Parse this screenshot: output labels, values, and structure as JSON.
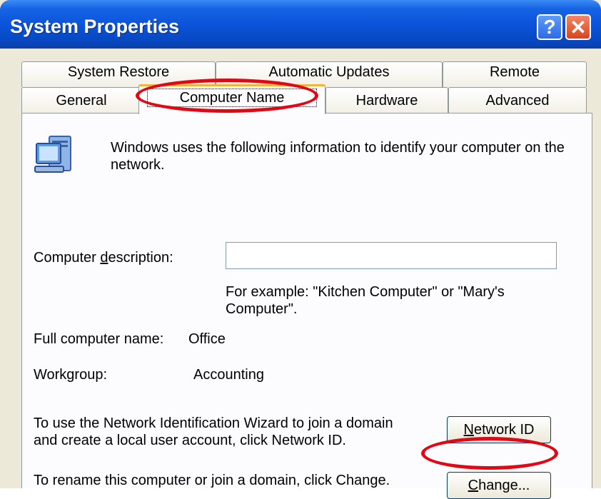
{
  "window": {
    "title": "System Properties"
  },
  "titlebar_buttons": {
    "help": "?",
    "close": "✕"
  },
  "tabs_row1": [
    "System Restore",
    "Automatic Updates",
    "Remote"
  ],
  "tabs_row2": [
    "General",
    "Computer Name",
    "Hardware",
    "Advanced"
  ],
  "active_tab": "Computer Name",
  "icon": "computer-network-icon",
  "intro": "Windows uses the following information to identify your computer on the network.",
  "description": {
    "label_pre": "Computer ",
    "label_accel": "d",
    "label_post": "escription:",
    "value": "",
    "example": "For example: \"Kitchen Computer\" or \"Mary's Computer\"."
  },
  "full_name": {
    "label": "Full computer name:",
    "value": "Office"
  },
  "workgroup": {
    "label": "Workgroup:",
    "value": "Accounting"
  },
  "network_id": {
    "text": "To use the Network Identification Wizard to join a domain and create a local user account, click Network ID.",
    "button_accel": "N",
    "button_rest": "etwork ID"
  },
  "rename": {
    "text": "To rename this computer or join a domain, click Change.",
    "button_accel": "C",
    "button_rest": "hange..."
  },
  "colors": {
    "annotation": "#e30613",
    "titlebar": "#0a52d8",
    "dialog_bg": "#ece9d8",
    "tab_highlight": "#f0b43c"
  }
}
